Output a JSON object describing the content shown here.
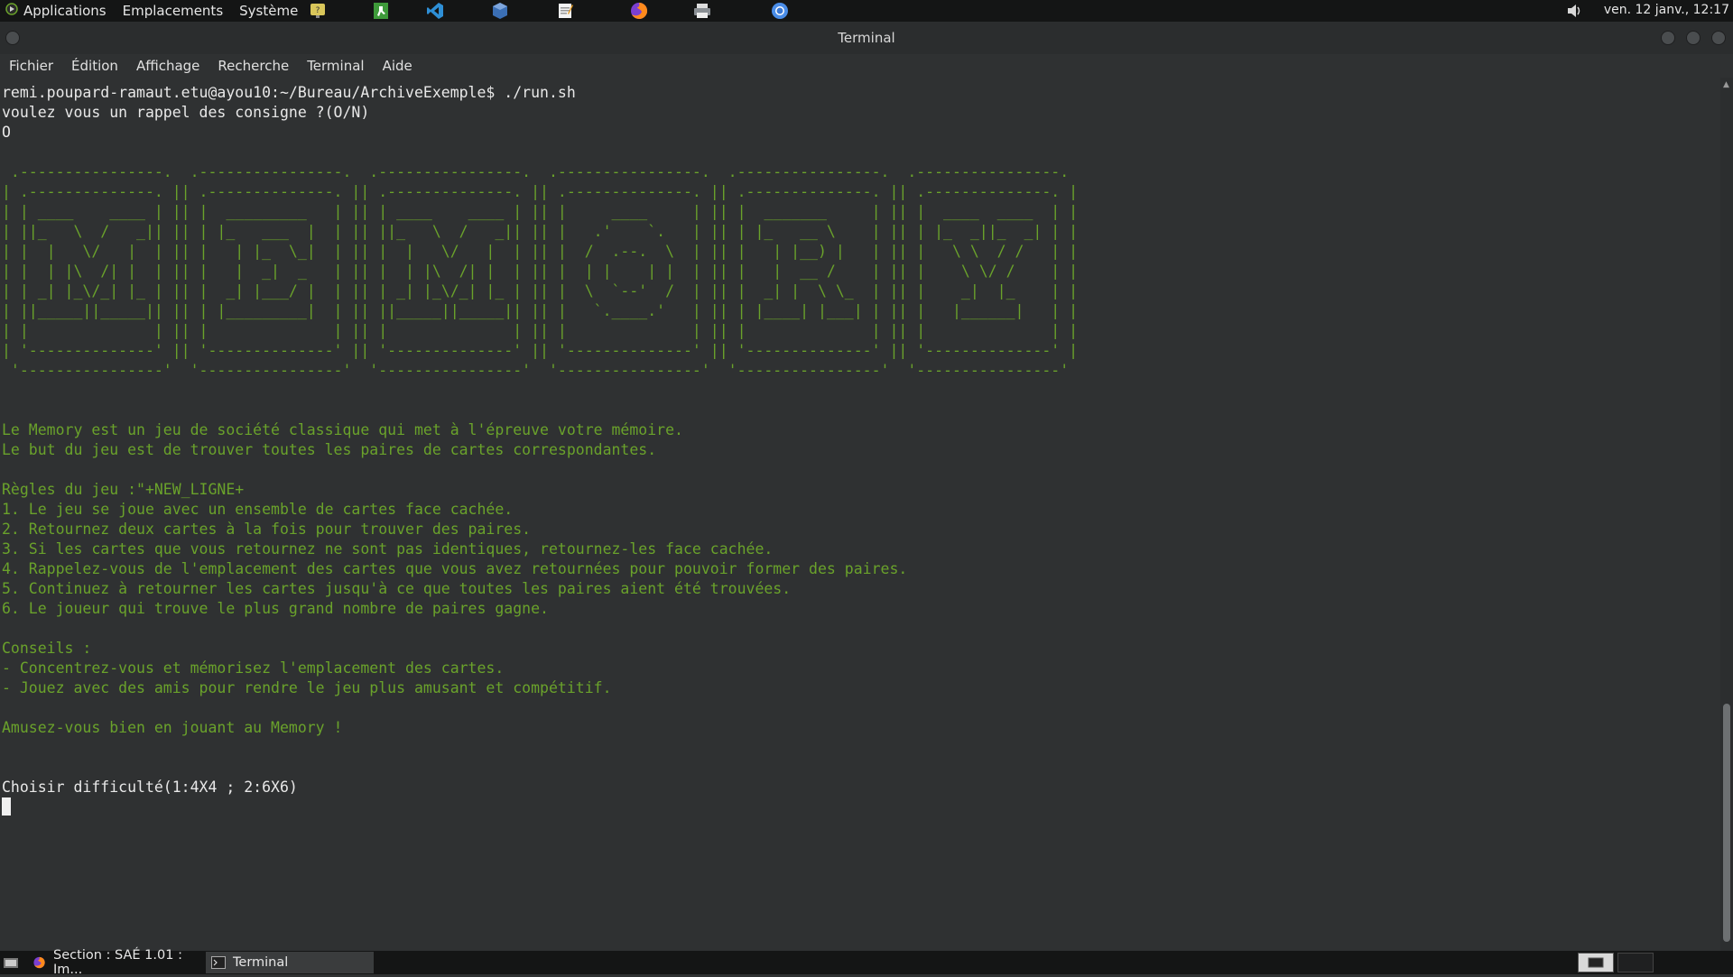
{
  "top_panel": {
    "menus": [
      "Applications",
      "Emplacements",
      "Système"
    ],
    "clock": "ven. 12 janv., 12:17"
  },
  "window": {
    "title": "Terminal"
  },
  "menubar": [
    "Fichier",
    "Édition",
    "Affichage",
    "Recherche",
    "Terminal",
    "Aide"
  ],
  "terminal": {
    "lines": [
      {
        "text": "remi.poupard-ramaut.etu@ayou10:~/Bureau/ArchiveExemple$ ./run.sh",
        "color": "#e8e8e8"
      },
      {
        "text": "voulez vous un rappel des consigne ?(O/N)",
        "color": "#e8e8e8"
      },
      {
        "text": "O",
        "color": "#e8e8e8"
      },
      {
        "text": "",
        "color": "#6aa22b"
      },
      {
        "text": " .----------------.  .----------------.  .----------------.  .----------------.  .----------------.  .----------------. ",
        "color": "#6aa22b"
      },
      {
        "text": "| .--------------. || .--------------. || .--------------. || .--------------. || .--------------. || .--------------. |",
        "color": "#6aa22b"
      },
      {
        "text": "| | ____    ____ | || |  _________   | || | ____    ____ | || |     ____     | || |  _______     | || |  ____  ____  | |",
        "color": "#6aa22b"
      },
      {
        "text": "| ||_   \\  /   _|| || | |_   ___  |  | || ||_   \\  /   _|| || |   .'    `.   | || | |_   __ \\    | || | |_  _||_  _| | |",
        "color": "#6aa22b"
      },
      {
        "text": "| |  |   \\/   |  | || |   | |_  \\_|  | || |  |   \\/   |  | || |  /  .--.  \\  | || |   | |__) |   | || |   \\ \\  / /   | |",
        "color": "#6aa22b"
      },
      {
        "text": "| |  | |\\  /| |  | || |   |  _|  _   | || |  | |\\  /| |  | || |  | |    | |  | || |   |  __ /    | || |    \\ \\/ /    | |",
        "color": "#6aa22b"
      },
      {
        "text": "| | _| |_\\/_| |_ | || |  _| |___/ |  | || | _| |_\\/_| |_ | || |  \\  `--'  /  | || |  _| |  \\ \\_  | || |    _|  |_    | |",
        "color": "#6aa22b"
      },
      {
        "text": "| ||_____||_____|| || | |_________|  | || ||_____||_____|| || |   `.____.'   | || | |____| |___| | || |   |______|   | |",
        "color": "#6aa22b"
      },
      {
        "text": "| |              | || |              | || |              | || |              | || |              | || |              | |",
        "color": "#6aa22b"
      },
      {
        "text": "| '--------------' || '--------------' || '--------------' || '--------------' || '--------------' || '--------------' |",
        "color": "#6aa22b"
      },
      {
        "text": " '----------------'  '----------------'  '----------------'  '----------------'  '----------------'  '----------------' ",
        "color": "#6aa22b"
      },
      {
        "text": "",
        "color": "#6aa22b"
      },
      {
        "text": "",
        "color": "#6aa22b"
      },
      {
        "text": "Le Memory est un jeu de société classique qui met à l'épreuve votre mémoire.",
        "color": "#6aa22b"
      },
      {
        "text": "Le but du jeu est de trouver toutes les paires de cartes correspondantes.",
        "color": "#6aa22b"
      },
      {
        "text": "",
        "color": "#6aa22b"
      },
      {
        "text": "Règles du jeu :\"+NEW_LIGNE+",
        "color": "#6aa22b"
      },
      {
        "text": "1. Le jeu se joue avec un ensemble de cartes face cachée.",
        "color": "#6aa22b"
      },
      {
        "text": "2. Retournez deux cartes à la fois pour trouver des paires.",
        "color": "#6aa22b"
      },
      {
        "text": "3. Si les cartes que vous retournez ne sont pas identiques, retournez-les face cachée.",
        "color": "#6aa22b"
      },
      {
        "text": "4. Rappelez-vous de l'emplacement des cartes que vous avez retournées pour pouvoir former des paires.",
        "color": "#6aa22b"
      },
      {
        "text": "5. Continuez à retourner les cartes jusqu'à ce que toutes les paires aient été trouvées.",
        "color": "#6aa22b"
      },
      {
        "text": "6. Le joueur qui trouve le plus grand nombre de paires gagne.",
        "color": "#6aa22b"
      },
      {
        "text": "",
        "color": "#6aa22b"
      },
      {
        "text": "Conseils :",
        "color": "#6aa22b"
      },
      {
        "text": "- Concentrez-vous et mémorisez l'emplacement des cartes.",
        "color": "#6aa22b"
      },
      {
        "text": "- Jouez avec des amis pour rendre le jeu plus amusant et compétitif.",
        "color": "#6aa22b"
      },
      {
        "text": "",
        "color": "#6aa22b"
      },
      {
        "text": "Amusez-vous bien en jouant au Memory !",
        "color": "#6aa22b"
      },
      {
        "text": "",
        "color": "#6aa22b"
      },
      {
        "text": "",
        "color": "#6aa22b"
      },
      {
        "text": "Choisir difficulté(1:4X4 ; 2:6X6)",
        "color": "#e8e8e8"
      }
    ]
  },
  "taskbar": {
    "tasks": [
      "Section : SAÉ 1.01 : Im...",
      "Terminal"
    ]
  },
  "colors": {
    "terminal_green": "#6aa22b",
    "terminal_white": "#e8e8e8",
    "background": "#2f3132"
  }
}
